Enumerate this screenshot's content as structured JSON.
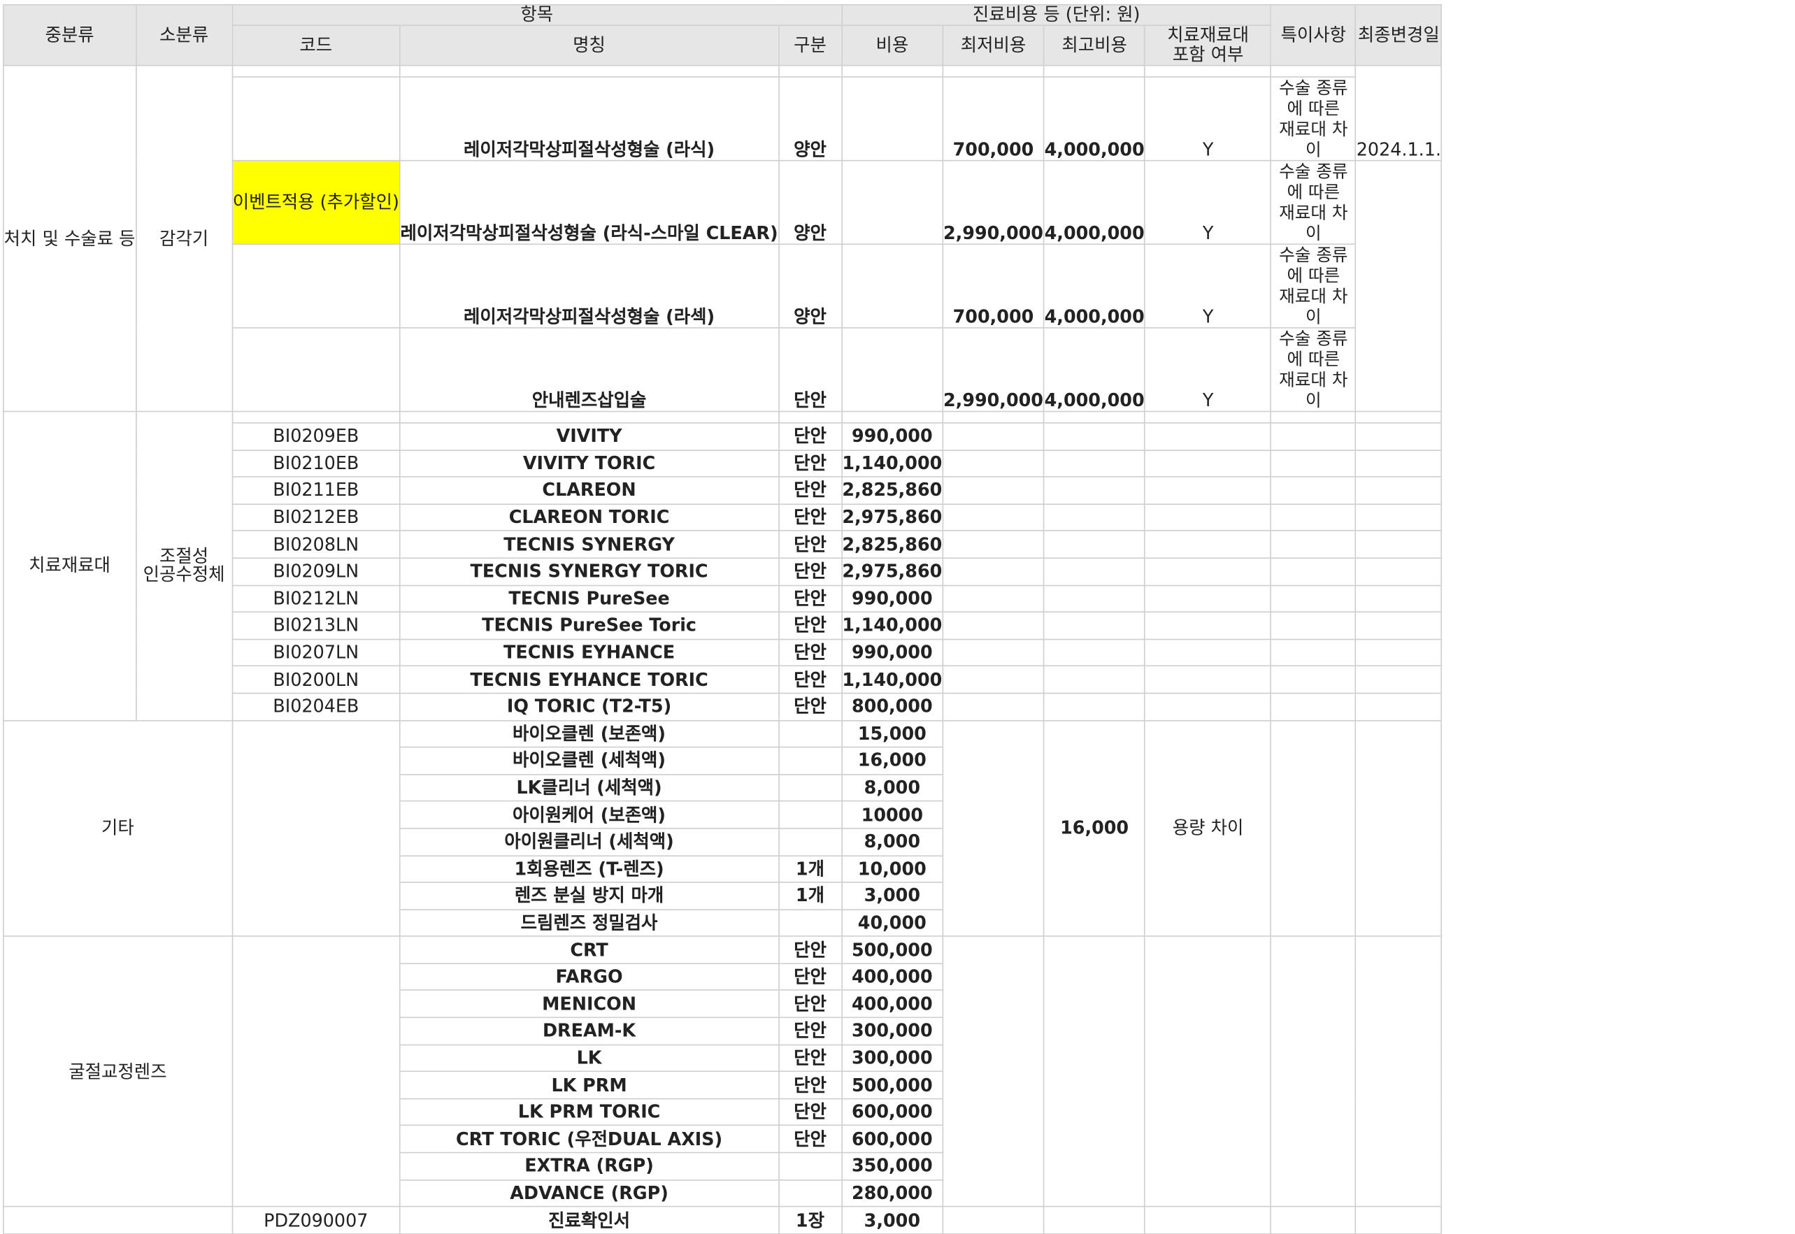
{
  "headers": {
    "mid_category": "중분류",
    "sub_category": "소분류",
    "item_group": "항목",
    "cost_group": "진료비용 등 (단위: 원)",
    "code": "코드",
    "name": "명칭",
    "division": "구분",
    "cost": "비용",
    "min_cost": "최저비용",
    "max_cost": "최고비용",
    "material_included_l1": "치료재료대",
    "material_included_l2": "포함 여부",
    "remarks": "특이사항",
    "last_changed": "최종변경일"
  },
  "surgery": {
    "mid": "처치 및 수술료 등",
    "sub": "감각기",
    "last_changed": "2024.1.1.",
    "rows": [
      {
        "code": "",
        "name": "레이저각막상피절삭성형술 (라식)",
        "division": "양안",
        "min": "700,000",
        "max": "4,000,000",
        "material": "Y",
        "remark_l1": "수술 종류에 따른",
        "remark_l2": "재료대 차이"
      },
      {
        "code": "이벤트적용 (추가할인)",
        "name": "레이저각막상피절삭성형술 (라식-스마일 CLEAR)",
        "division": "양안",
        "min": "2,990,000",
        "max": "4,000,000",
        "material": "Y",
        "remark_l1": "수술 종류에 따른",
        "remark_l2": "재료대 차이"
      },
      {
        "code": "",
        "name": "레이저각막상피절삭성형술 (라섹)",
        "division": "양안",
        "min": "700,000",
        "max": "4,000,000",
        "material": "Y",
        "remark_l1": "수술 종류에 따른",
        "remark_l2": "재료대 차이"
      },
      {
        "code": "",
        "name": "안내렌즈삽입술",
        "division": "단안",
        "min": "2,990,000",
        "max": "4,000,000",
        "material": "Y",
        "remark_l1": "수술 종류에 따른",
        "remark_l2": "재료대 차이"
      }
    ]
  },
  "materials": {
    "mid": "치료재료대",
    "sub_l1": "조절성",
    "sub_l2": "인공수정체",
    "rows": [
      {
        "code": "BI0209EB",
        "name": "VIVITY",
        "division": "단안",
        "cost": "990,000"
      },
      {
        "code": "BI0210EB",
        "name": "VIVITY TORIC",
        "division": "단안",
        "cost": "1,140,000"
      },
      {
        "code": "BI0211EB",
        "name": "CLAREON",
        "division": "단안",
        "cost": "2,825,860"
      },
      {
        "code": "BI0212EB",
        "name": "CLAREON TORIC",
        "division": "단안",
        "cost": "2,975,860"
      },
      {
        "code": "BI0208LN",
        "name": "TECNIS SYNERGY",
        "division": "단안",
        "cost": "2,825,860"
      },
      {
        "code": "BI0209LN",
        "name": "TECNIS SYNERGY TORIC",
        "division": "단안",
        "cost": "2,975,860"
      },
      {
        "code": "BI0212LN",
        "name": "TECNIS PureSee",
        "division": "단안",
        "cost": "990,000"
      },
      {
        "code": "BI0213LN",
        "name": "TECNIS PureSee Toric",
        "division": "단안",
        "cost": "1,140,000"
      },
      {
        "code": "BI0207LN",
        "name": "TECNIS EYHANCE",
        "division": "단안",
        "cost": "990,000"
      },
      {
        "code": "BI0200LN",
        "name": "TECNIS EYHANCE TORIC",
        "division": "단안",
        "cost": "1,140,000"
      },
      {
        "code": "BI0204EB",
        "name": "IQ TORIC (T2-T5)",
        "division": "단안",
        "cost": "800,000"
      }
    ]
  },
  "etc": {
    "label": "기타",
    "max_cost": "16,000",
    "material_note": "용량 차이",
    "rows": [
      {
        "name": "바이오클렌 (보존액)",
        "division": "",
        "cost": "15,000"
      },
      {
        "name": "바이오클렌 (세척액)",
        "division": "",
        "cost": "16,000"
      },
      {
        "name": "LK클리너 (세척액)",
        "division": "",
        "cost": "8,000"
      },
      {
        "name": "아이원케어 (보존액)",
        "division": "",
        "cost": "10000"
      },
      {
        "name": "아이원클리너 (세척액)",
        "division": "",
        "cost": "8,000"
      },
      {
        "name": "1회용렌즈 (T-렌즈)",
        "division": "1개",
        "cost": "10,000"
      },
      {
        "name": "렌즈 분실 방지 마개",
        "division": "1개",
        "cost": "3,000"
      },
      {
        "name": "드림렌즈 정밀검사",
        "division": "",
        "cost": "40,000"
      }
    ]
  },
  "ortho": {
    "label": "굴절교정렌즈",
    "rows": [
      {
        "name": "CRT",
        "division": "단안",
        "cost": "500,000"
      },
      {
        "name": "FARGO",
        "division": "단안",
        "cost": "400,000"
      },
      {
        "name": "MENICON",
        "division": "단안",
        "cost": "400,000"
      },
      {
        "name": "DREAM-K",
        "division": "단안",
        "cost": "300,000"
      },
      {
        "name": "LK",
        "division": "단안",
        "cost": "300,000"
      },
      {
        "name": "LK PRM",
        "division": "단안",
        "cost": "500,000"
      },
      {
        "name": "LK PRM TORIC",
        "division": "단안",
        "cost": "600,000"
      },
      {
        "name": "CRT TORIC (우전DUAL AXIS)",
        "division": "단안",
        "cost": "600,000"
      },
      {
        "name": "EXTRA (RGP)",
        "division": "",
        "cost": "350,000"
      },
      {
        "name": "ADVANCE (RGP)",
        "division": "",
        "cost": "280,000"
      }
    ]
  },
  "certificate": {
    "code": "PDZ090007",
    "name": "진료확인서",
    "division": "1장",
    "cost": "3,000"
  },
  "colors": {
    "header_bg": "#e6e6e6",
    "highlight": "#ffff00",
    "border": "#cfcfcf"
  }
}
